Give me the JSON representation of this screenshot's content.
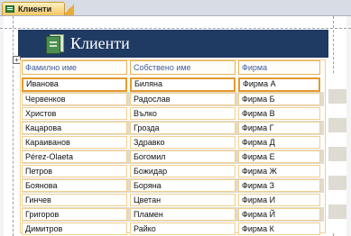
{
  "tab": {
    "label": "Клиенти"
  },
  "header": {
    "title": "Клиенти"
  },
  "columns": [
    "Фамилно име",
    "Собствено име",
    "Фирма"
  ],
  "rows": [
    [
      "Иванова",
      "Биляна",
      "Фирма А"
    ],
    [
      "Червенков",
      "Радослав",
      "Фирма Б"
    ],
    [
      "Христов",
      "Вълко",
      "Фирма В"
    ],
    [
      "Кацарова",
      "Грозда",
      "Фирма Г"
    ],
    [
      "Караиванов",
      "Здравко",
      "Фирма Д"
    ],
    [
      "Pérez-Olaeta",
      "Богомил",
      "Фирма Е"
    ],
    [
      "Петров",
      "Божидар",
      "Фирма Ж"
    ],
    [
      "Боянова",
      "Боряна",
      "Фирма З"
    ],
    [
      "Гинчев",
      "Цветан",
      "Фирма И"
    ],
    [
      "Григоров",
      "Пламен",
      "Фирма Й"
    ],
    [
      "Димитров",
      "Райко",
      "Фирма К"
    ]
  ],
  "colors": {
    "header_bg": "#1f3a63",
    "tab_bg": "#f3c766",
    "field_border": "#e6b25a"
  }
}
